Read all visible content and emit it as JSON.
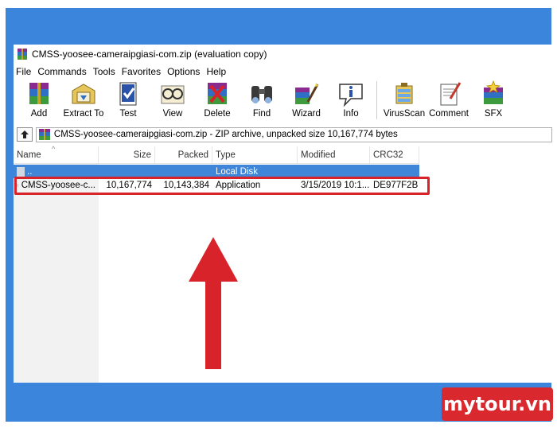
{
  "window": {
    "title": "CMSS-yoosee-cameraipgiasi-com.zip (evaluation copy)"
  },
  "menu": [
    "File",
    "Commands",
    "Tools",
    "Favorites",
    "Options",
    "Help"
  ],
  "toolbar": {
    "add": "Add",
    "extract": "Extract To",
    "test": "Test",
    "view": "View",
    "delete": "Delete",
    "find": "Find",
    "wizard": "Wizard",
    "info": "Info",
    "virusscan": "VirusScan",
    "comment": "Comment",
    "sfx": "SFX"
  },
  "path": {
    "text": "CMSS-yoosee-cameraipgiasi-com.zip - ZIP archive, unpacked size 10,167,774 bytes"
  },
  "columns": {
    "name": "Name",
    "size": "Size",
    "packed": "Packed",
    "type": "Type",
    "modified": "Modified",
    "crc": "CRC32"
  },
  "rows": {
    "parent": {
      "name": "..",
      "type": "Local Disk"
    },
    "file": {
      "name": "CMSS-yoosee-c...",
      "size": "10,167,774",
      "packed": "10,143,384",
      "type": "Application",
      "modified": "3/15/2019 10:1...",
      "crc": "DE977F2B"
    }
  },
  "watermark": "mytour.vn",
  "colors": {
    "background_blue": "#3b86dc",
    "selection_blue": "#3f85d8",
    "highlight_red": "#d8232a",
    "watermark_red": "#d9282e"
  },
  "icons": [
    "winrar-icon",
    "add-icon",
    "extract-icon",
    "test-icon",
    "view-icon",
    "delete-icon",
    "find-icon",
    "wizard-icon",
    "info-icon",
    "virusscan-icon",
    "comment-icon",
    "sfx-icon",
    "up-folder-icon",
    "archive-icon",
    "exe-file-icon",
    "red-arrow"
  ]
}
